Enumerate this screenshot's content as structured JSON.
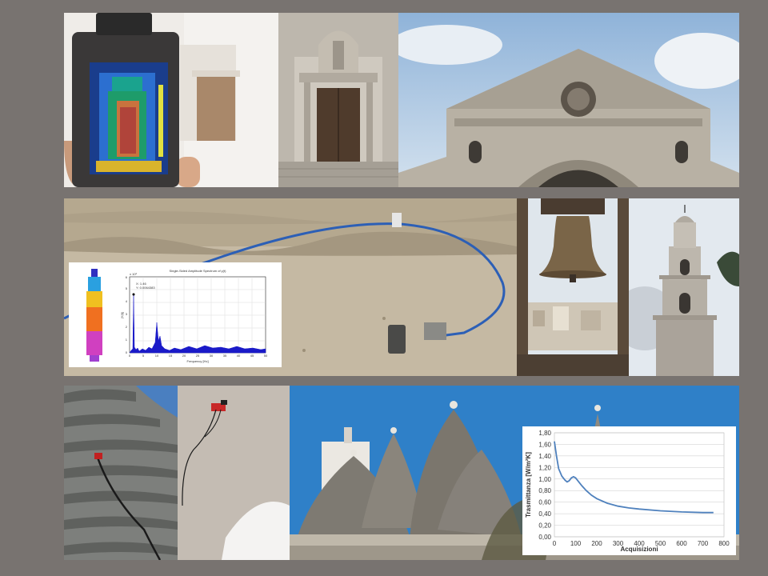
{
  "spectrum_chart": {
    "title": "Single-Sided Amplitude Spectrum of y(t)",
    "exponent": "x 10³",
    "marker_x": "X: 1.46",
    "marker_y": "Y: 0.0064383",
    "xlabel": "Frequency [Hz]",
    "ylabel": "|Y(f)|",
    "x_ticks": [
      "0",
      "5",
      "10",
      "15",
      "20",
      "25",
      "30",
      "35",
      "40",
      "45",
      "50"
    ],
    "y_ticks": [
      "0",
      "1",
      "2",
      "3",
      "4",
      "5",
      "6"
    ]
  },
  "chart_data": {
    "type": "line",
    "title": "",
    "xlabel": "Acquisizioni",
    "ylabel": "Trasmittanza [W/m²K]",
    "xlim": [
      0,
      800
    ],
    "ylim": [
      0.0,
      1.8
    ],
    "x_ticks": [
      "0",
      "100",
      "200",
      "300",
      "400",
      "500",
      "600",
      "700",
      "800"
    ],
    "y_ticks": [
      "0,00",
      "0,20",
      "0,40",
      "0,60",
      "0,80",
      "1,00",
      "1,20",
      "1,40",
      "1,60",
      "1,80"
    ],
    "grid": true,
    "series": [
      {
        "color": "#4f81bd",
        "points": [
          [
            0,
            1.65
          ],
          [
            10,
            1.4
          ],
          [
            20,
            1.18
          ],
          [
            35,
            1.05
          ],
          [
            50,
            0.98
          ],
          [
            60,
            0.95
          ],
          [
            70,
            0.97
          ],
          [
            80,
            1.02
          ],
          [
            90,
            1.04
          ],
          [
            100,
            1.02
          ],
          [
            115,
            0.95
          ],
          [
            130,
            0.88
          ],
          [
            150,
            0.8
          ],
          [
            175,
            0.72
          ],
          [
            200,
            0.66
          ],
          [
            250,
            0.58
          ],
          [
            300,
            0.53
          ],
          [
            350,
            0.5
          ],
          [
            400,
            0.48
          ],
          [
            500,
            0.45
          ],
          [
            600,
            0.43
          ],
          [
            700,
            0.42
          ],
          [
            750,
            0.42
          ]
        ]
      }
    ]
  }
}
